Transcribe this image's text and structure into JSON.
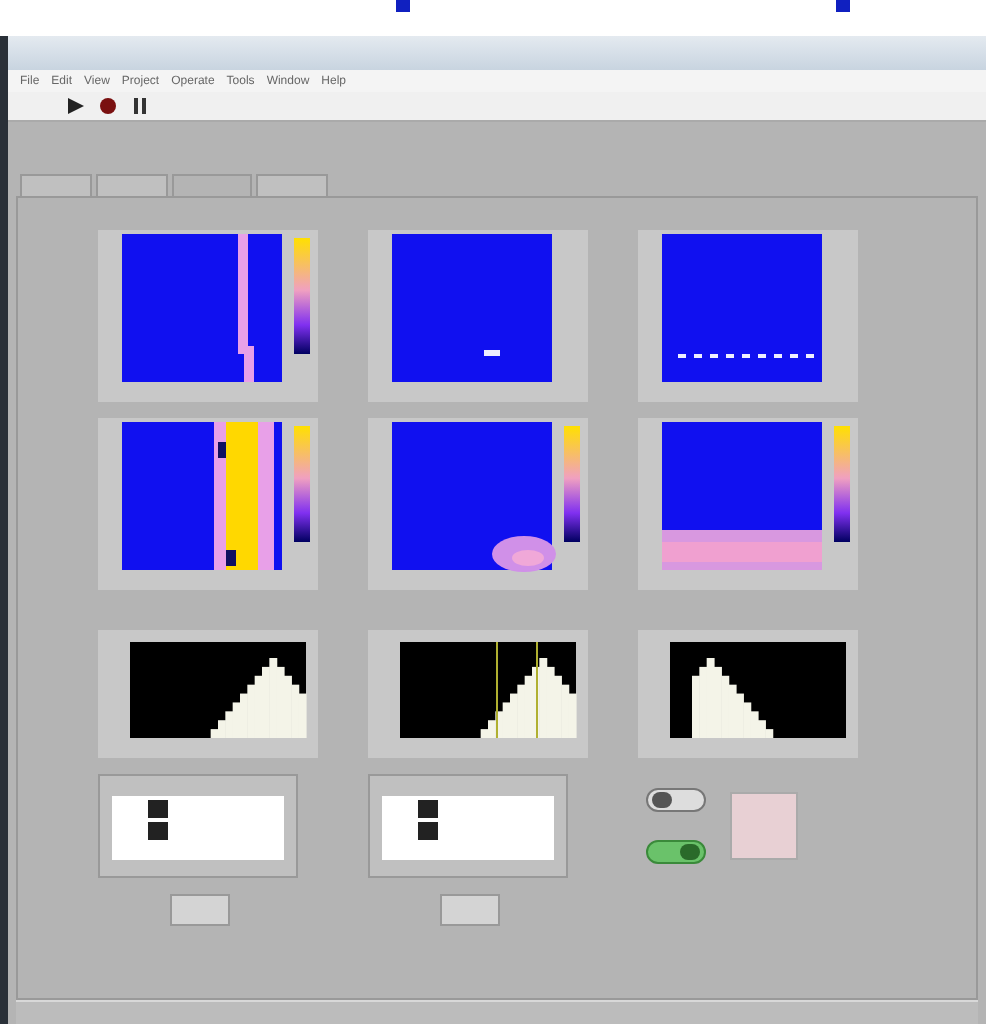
{
  "window": {
    "menu": [
      "File",
      "Edit",
      "View",
      "Project",
      "Operate",
      "Tools",
      "Window",
      "Help"
    ]
  },
  "tabs": [
    {
      "selected": false
    },
    {
      "selected": false
    },
    {
      "selected": true
    },
    {
      "selected": false
    }
  ],
  "maps": [
    {
      "kind": "stripe"
    },
    {
      "kind": "dots"
    },
    {
      "kind": "dashes"
    },
    {
      "kind": "wide-stripe"
    },
    {
      "kind": "blob"
    },
    {
      "kind": "band"
    }
  ],
  "histograms": [
    {
      "kind": "right"
    },
    {
      "kind": "cursors"
    },
    {
      "kind": "left"
    }
  ],
  "switches": [
    {
      "on": false
    },
    {
      "on": true
    }
  ]
}
